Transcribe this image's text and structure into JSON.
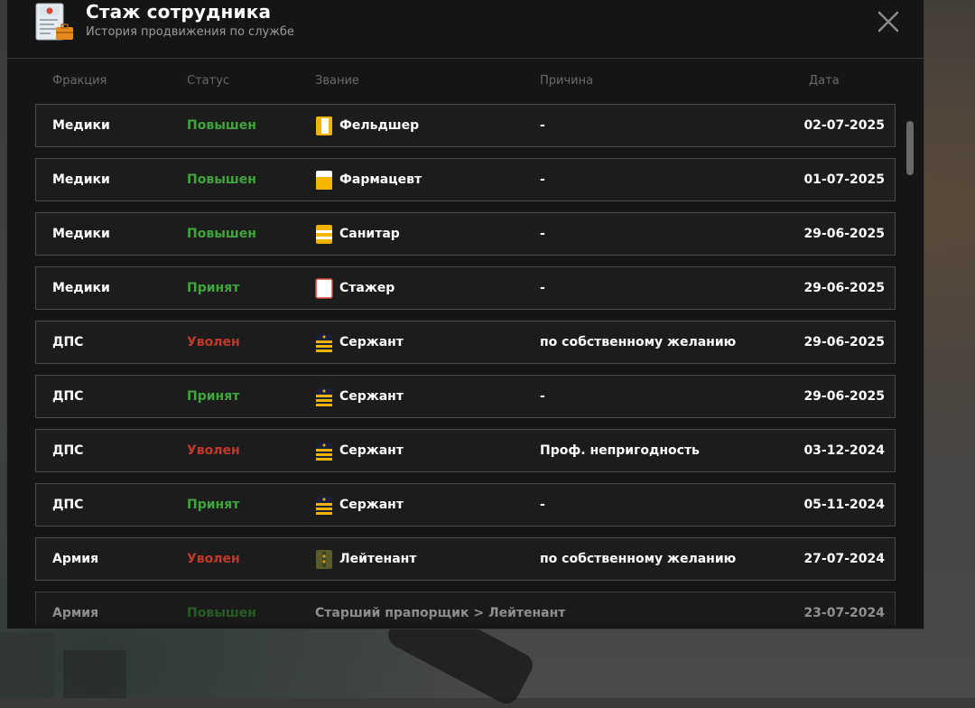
{
  "header": {
    "title": "Стаж сотрудника",
    "subtitle": "История продвижения по службе"
  },
  "columns": {
    "faction": "Фракция",
    "status": "Статус",
    "rank": "Звание",
    "reason": "Причина",
    "date": "Дата"
  },
  "rows": [
    {
      "faction": "Медики",
      "status": "Повышен",
      "status_type": "up",
      "rank": "Фельдшер",
      "rank_icon": "paramedic-badge-icon",
      "reason": "-",
      "date": "02-07-2025"
    },
    {
      "faction": "Медики",
      "status": "Повышен",
      "status_type": "up",
      "rank": "Фармацевт",
      "rank_icon": "pharmacist-badge-icon",
      "reason": "-",
      "date": "01-07-2025"
    },
    {
      "faction": "Медики",
      "status": "Повышен",
      "status_type": "up",
      "rank": "Санитар",
      "rank_icon": "orderly-badge-icon",
      "reason": "-",
      "date": "29-06-2025"
    },
    {
      "faction": "Медики",
      "status": "Принят",
      "status_type": "up",
      "rank": "Стажер",
      "rank_icon": "intern-badge-icon",
      "reason": "-",
      "date": "29-06-2025"
    },
    {
      "faction": "ДПС",
      "status": "Уволен",
      "status_type": "fired",
      "rank": "Сержант",
      "rank_icon": "sergeant-stripes-icon",
      "reason": "по собственному желанию",
      "date": "29-06-2025"
    },
    {
      "faction": "ДПС",
      "status": "Принят",
      "status_type": "up",
      "rank": "Сержант",
      "rank_icon": "sergeant-stripes-icon",
      "reason": "-",
      "date": "29-06-2025"
    },
    {
      "faction": "ДПС",
      "status": "Уволен",
      "status_type": "fired",
      "rank": "Сержант",
      "rank_icon": "sergeant-stripes-icon",
      "reason": "Проф. непригодность",
      "date": "03-12-2024"
    },
    {
      "faction": "ДПС",
      "status": "Принят",
      "status_type": "up",
      "rank": "Сержант",
      "rank_icon": "sergeant-stripes-icon",
      "reason": "-",
      "date": "05-11-2024"
    },
    {
      "faction": "Армия",
      "status": "Уволен",
      "status_type": "fired",
      "rank": "Лейтенант",
      "rank_icon": "army-lieutenant-icon",
      "reason": "по собственному желанию",
      "date": "27-07-2024"
    },
    {
      "faction": "Армия",
      "status": "Повышен",
      "status_type": "up",
      "rank": "Старший прапорщик > Лейтенант",
      "rank_icon": "",
      "reason": "-",
      "date": "23-07-2024"
    }
  ],
  "colors": {
    "status_up": "#3fa53a",
    "status_fired": "#c0392b",
    "background": "#151515"
  },
  "icons": {
    "header": "employee-record-icon",
    "close": "close-icon"
  }
}
